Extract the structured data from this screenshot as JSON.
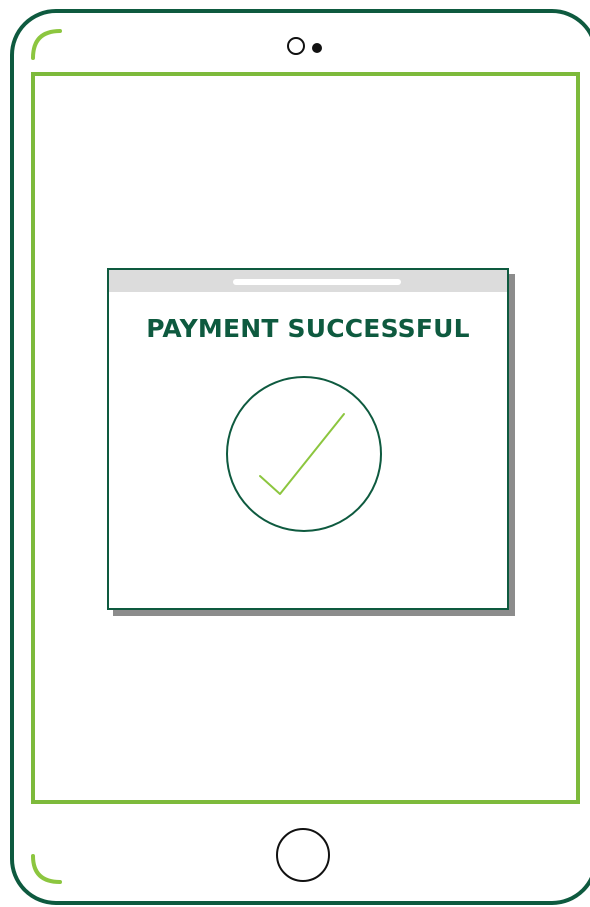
{
  "dialog": {
    "title": "PAYMENT SUCCESSFUL",
    "icon": "check-circle-icon"
  },
  "device": {
    "icons": [
      "camera-icon",
      "sensor-icon",
      "home-button-icon"
    ]
  },
  "colors": {
    "frame": "#0e5a3f",
    "screen_border": "#7dba3b",
    "accent": "#8cc63f",
    "title": "#0e5a3f",
    "shadow": "#8c8c8c",
    "title_bar": "#dcdcdc"
  }
}
